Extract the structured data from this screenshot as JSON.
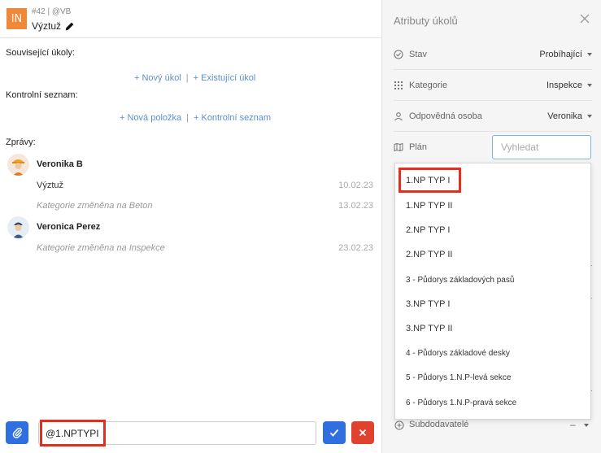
{
  "task": {
    "badge": "IN",
    "id_line": "#42 | @VB",
    "title": "Výztuž"
  },
  "related_tasks": {
    "label": "Související úkoly:",
    "new_link": "+ Nový úkol",
    "separator": "|",
    "existing_link": "+ Existující úkol"
  },
  "checklist": {
    "label": "Kontrolní seznam:",
    "new_link": "+ Nová položka",
    "separator": "|",
    "existing_link": "+ Kontrolní seznam"
  },
  "messages": {
    "label": "Zprávy:",
    "threads": [
      {
        "author": "Veronika B",
        "entries": [
          {
            "text": "Výztuž",
            "date": "10.02.23",
            "italic": false
          },
          {
            "text": "Kategorie změněna na Beton",
            "date": "13.02.23",
            "italic": true
          }
        ]
      },
      {
        "author": "Veronica Perez",
        "entries": [
          {
            "text": "Kategorie změněna na Inspekce",
            "date": "23.02.23",
            "italic": true
          }
        ]
      }
    ]
  },
  "composer": {
    "value": "@1.NPTYPI"
  },
  "attributes_panel": {
    "title": "Atributy úkolů",
    "rows": [
      {
        "icon": "check-circle-icon",
        "label": "Stav",
        "value": "Probíhající"
      },
      {
        "icon": "grid-icon",
        "label": "Kategorie",
        "value": "Inspekce"
      },
      {
        "icon": "person-icon",
        "label": "Odpovědná osoba",
        "value": "Veronika"
      },
      {
        "icon": "map-icon",
        "label": "Plán",
        "value": ""
      }
    ],
    "search_placeholder": "Vyhledat",
    "plan_options": [
      "1.NP TYP I",
      "1.NP TYP II",
      "2.NP TYP I",
      "2.NP TYP II",
      "3 - Půdorys základových pasů",
      "3.NP TYP I",
      "3.NP TYP II",
      "4 - Půdorys základové desky",
      "5 - Půdorys 1.N.P-levá sekce",
      "6 - Půdorys 1.N.P-pravá sekce"
    ],
    "subcontractors": {
      "label": "Subdodavatelé",
      "value": "–"
    }
  },
  "colors": {
    "accent_blue": "#2f6fe0",
    "danger_red": "#e0422f",
    "badge_orange": "#f0883a",
    "link_blue": "#5b8fd1",
    "highlight_red": "#e0301e"
  }
}
